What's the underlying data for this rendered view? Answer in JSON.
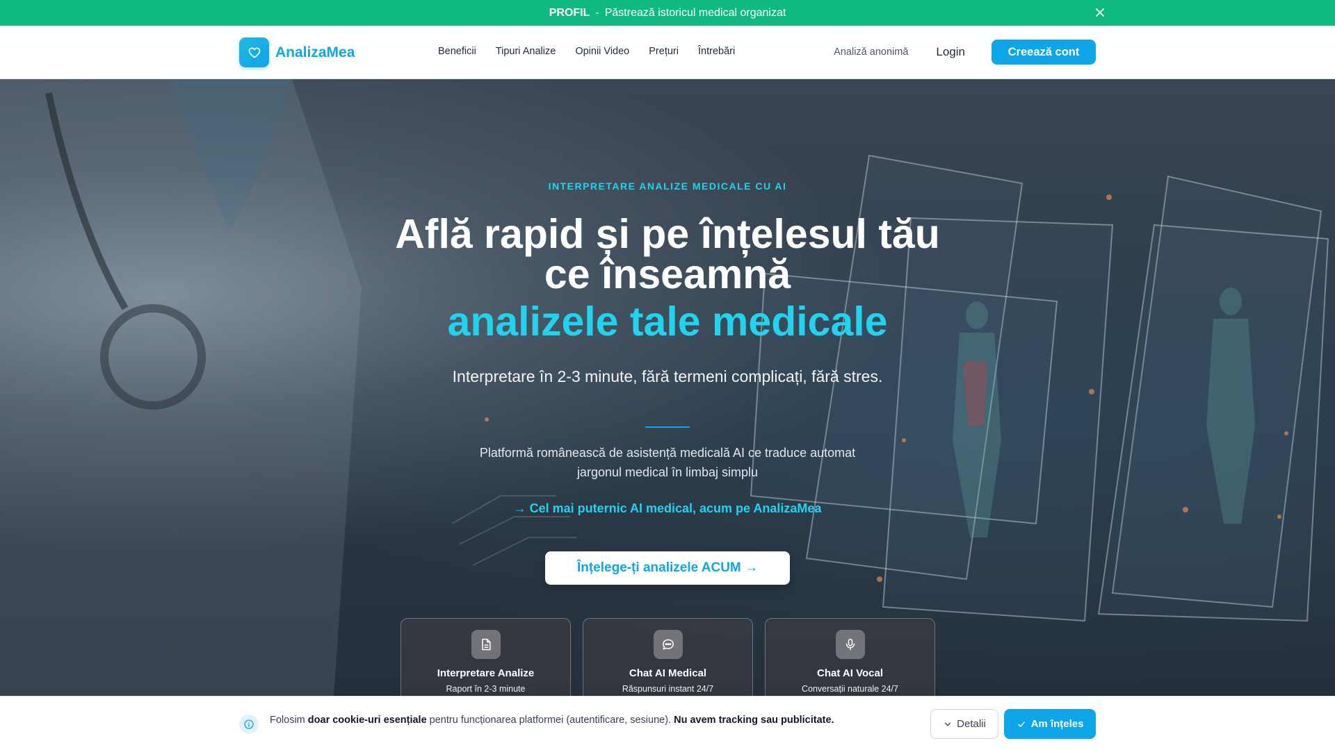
{
  "banner": {
    "strong": "PROFIL",
    "separator": "-",
    "text": "Păstrează istoricul medical organizat"
  },
  "header": {
    "logo_text": "AnalizaMea",
    "nav": [
      "Beneficii",
      "Tipuri Analize",
      "Opinii Video",
      "Prețuri",
      "Întrebări"
    ],
    "anon_label": "Analiză anonimă",
    "login_label": "Login",
    "signup_label": "Creează cont"
  },
  "hero": {
    "eyebrow": "INTERPRETARE ANALIZE MEDICALE CU AI",
    "title_line1": "Află rapid și pe înțelesul tău",
    "title_line2": "ce înseamnă",
    "title_accent": "analizele tale medicale",
    "subtitle": "Interpretare în 2-3 minute, fără termeni complicați, fără stres.",
    "description": "Platformă românească de asistență medicală AI ce traduce automat jargonul medical în limbaj simplu",
    "promo": "→ Cel mai puternic AI medical, acum pe AnalizaMea",
    "cta_label": "Înțelege-ți analizele ACUM →",
    "cards": [
      {
        "title": "Interpretare Analize",
        "subtitle": "Raport în 2-3 minute",
        "icon": "document-icon"
      },
      {
        "title": "Chat AI Medical",
        "subtitle": "Răspunsuri instant 24/7",
        "icon": "chat-bubble-icon"
      },
      {
        "title": "Chat AI Vocal",
        "subtitle": "Conversații naturale 24/7",
        "icon": "microphone-icon"
      }
    ]
  },
  "cookie": {
    "text_pre": "Folosim",
    "text_bold1": "doar cookie-uri esențiale",
    "text_mid": "pentru funcționarea platformei (autentificare, sesiune).",
    "text_bold2": "Nu avem tracking sau publicitate.",
    "details_label": "Detalii",
    "ok_label": "Am înțeles"
  },
  "colors": {
    "primary": "#0ea5e9",
    "accent": "#22d3ee",
    "banner": "#10b981"
  }
}
